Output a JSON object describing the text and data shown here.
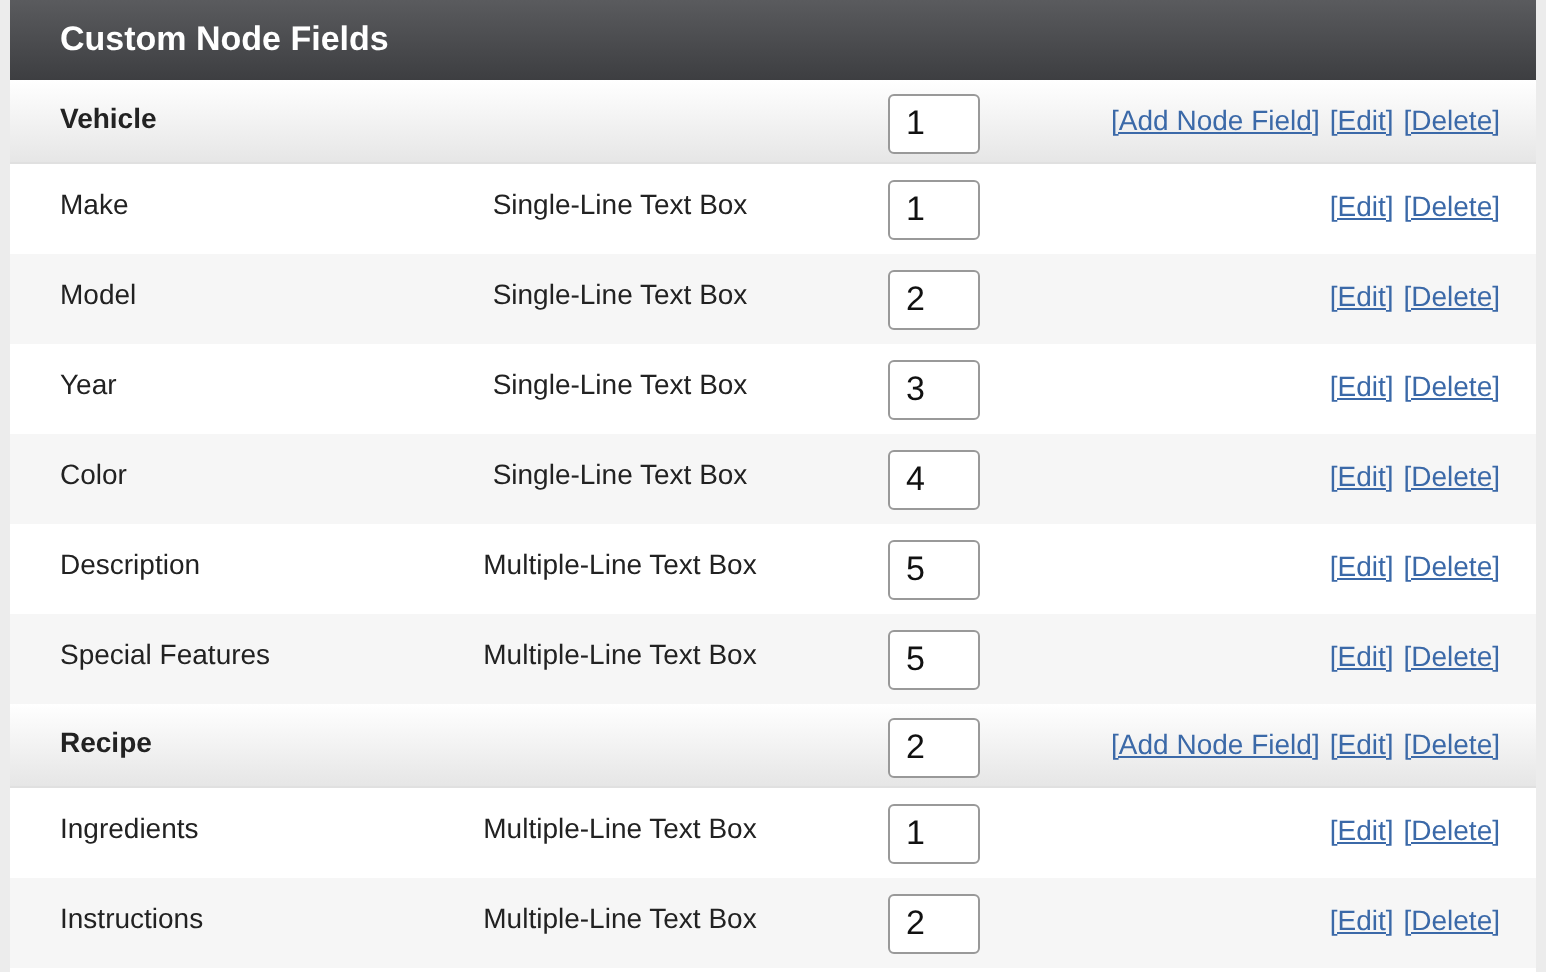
{
  "panel": {
    "title": "Custom Node Fields"
  },
  "rows": [
    {
      "kind": "group",
      "name": "Vehicle",
      "order": "1",
      "links": [
        "[Add Node Field]",
        "[Edit]",
        "[Delete]"
      ]
    },
    {
      "kind": "field",
      "name": "Make",
      "type": "Single-Line Text Box",
      "order": "1",
      "links": [
        "[Edit]",
        "[Delete]"
      ]
    },
    {
      "kind": "field",
      "name": "Model",
      "type": "Single-Line Text Box",
      "order": "2",
      "links": [
        "[Edit]",
        "[Delete]"
      ]
    },
    {
      "kind": "field",
      "name": "Year",
      "type": "Single-Line Text Box",
      "order": "3",
      "links": [
        "[Edit]",
        "[Delete]"
      ]
    },
    {
      "kind": "field",
      "name": "Color",
      "type": "Single-Line Text Box",
      "order": "4",
      "links": [
        "[Edit]",
        "[Delete]"
      ]
    },
    {
      "kind": "field",
      "name": "Description",
      "type": "Multiple-Line Text Box",
      "order": "5",
      "links": [
        "[Edit]",
        "[Delete]"
      ]
    },
    {
      "kind": "field",
      "name": "Special Features",
      "type": "Multiple-Line Text Box",
      "order": "5",
      "links": [
        "[Edit]",
        "[Delete]"
      ]
    },
    {
      "kind": "group",
      "name": "Recipe",
      "order": "2",
      "links": [
        "[Add Node Field]",
        "[Edit]",
        "[Delete]"
      ]
    },
    {
      "kind": "field",
      "name": "Ingredients",
      "type": "Multiple-Line Text Box",
      "order": "1",
      "links": [
        "[Edit]",
        "[Delete]"
      ]
    },
    {
      "kind": "field",
      "name": "Instructions",
      "type": "Multiple-Line Text Box",
      "order": "2",
      "links": [
        "[Edit]",
        "[Delete]"
      ]
    }
  ]
}
